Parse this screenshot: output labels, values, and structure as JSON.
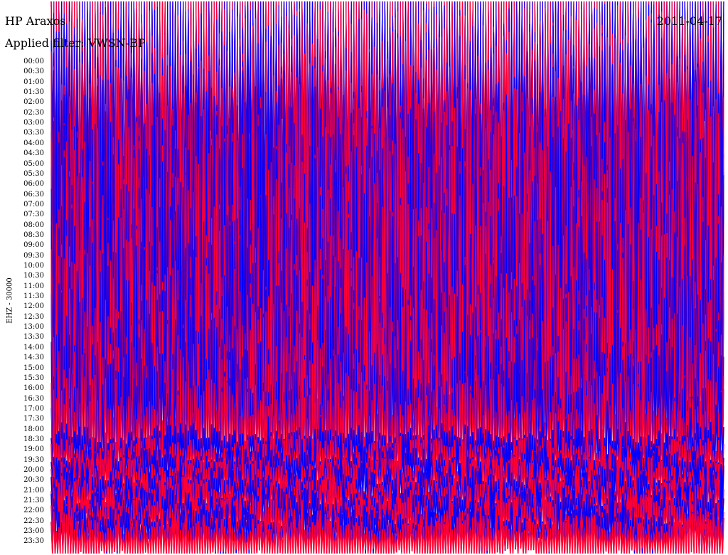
{
  "header": {
    "station": "HP Araxos",
    "filter": "Applied filter: VWSN-BP",
    "date": "2011-04-17"
  },
  "colors": {
    "trace_a": "#0000ff",
    "trace_b": "#ff0033",
    "background": "#ffffff",
    "text": "#000000"
  },
  "chart_data": {
    "type": "line",
    "title": "HP Araxos",
    "subtitle": "Applied filter: VWSN-BP",
    "ylabel": "EHZ - 30000",
    "xlabel": "",
    "grid": false,
    "rows": [
      "00:00",
      "00:30",
      "01:00",
      "01:30",
      "02:00",
      "02:30",
      "03:00",
      "03:30",
      "04:00",
      "04:30",
      "05:00",
      "05:30",
      "06:00",
      "06:30",
      "07:00",
      "07:30",
      "08:00",
      "08:30",
      "09:00",
      "09:30",
      "10:00",
      "10:30",
      "11:00",
      "11:30",
      "12:00",
      "12:30",
      "13:00",
      "13:30",
      "14:00",
      "14:30",
      "15:00",
      "15:30",
      "16:00",
      "16:30",
      "17:00",
      "17:30",
      "18:00",
      "18:30",
      "19:00",
      "19:30",
      "20:00",
      "20:30",
      "21:00",
      "21:30",
      "22:00",
      "22:30",
      "23:00",
      "23:30"
    ],
    "row_colors": [
      "#0000ff",
      "#ff0033"
    ],
    "relative_amplitude": [
      1.0,
      1.0,
      1.0,
      1.0,
      1.0,
      1.0,
      1.0,
      1.0,
      1.0,
      1.0,
      1.0,
      1.0,
      1.0,
      1.0,
      1.0,
      1.0,
      1.0,
      1.0,
      1.0,
      1.0,
      1.0,
      1.0,
      1.0,
      1.0,
      1.0,
      1.0,
      1.0,
      1.0,
      0.95,
      0.9,
      0.85,
      0.8,
      0.75,
      0.7,
      0.6,
      0.5,
      0.45,
      0.3,
      0.12,
      0.11,
      0.11,
      0.11,
      0.11,
      0.11,
      0.11,
      0.12,
      0.12,
      0.13
    ]
  }
}
